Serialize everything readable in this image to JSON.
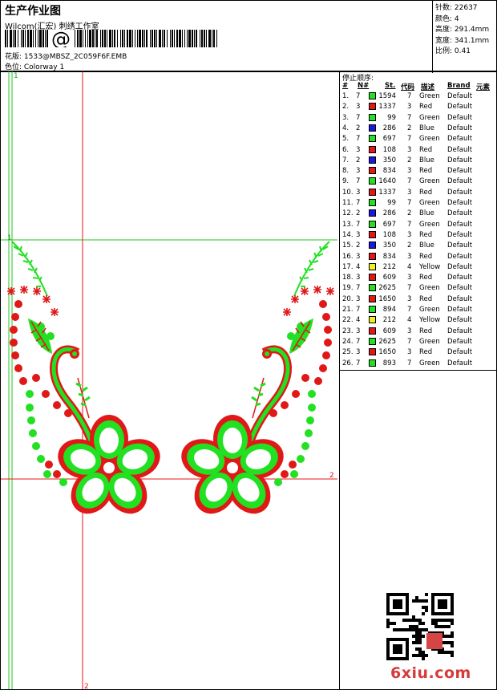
{
  "header": {
    "title": "生产作业图",
    "company": "Wilcom(汇宏) 刺绣工作室",
    "barcode_symbol": "@",
    "design_file": "花版: 1533@MBSZ_2C059F6F.EMB",
    "colorway": "色位: Colorway 1"
  },
  "stats": [
    "针数: 22637",
    "颜色: 4",
    "高度: 291.4mm",
    "宽度: 341.1mm",
    "比例: 0.41"
  ],
  "guides": {
    "v1_label": "1",
    "h1_label": "1",
    "h2_label": "2",
    "v2_label": "2"
  },
  "sequence": {
    "title": "停止顺序:",
    "columns": [
      "#",
      "N#",
      "St.",
      "代码",
      "描述",
      "Brand",
      "元素"
    ],
    "colors": {
      "Green": "#22e022",
      "Red": "#e01818",
      "Blue": "#1818e0",
      "Yellow": "#f0f020"
    },
    "rows": [
      [
        "1.",
        "7",
        "Green",
        "1594",
        "7",
        "Green",
        "Default"
      ],
      [
        "2.",
        "3",
        "Red",
        "1337",
        "3",
        "Red",
        "Default"
      ],
      [
        "3.",
        "7",
        "Green",
        "99",
        "7",
        "Green",
        "Default"
      ],
      [
        "4.",
        "2",
        "Blue",
        "286",
        "2",
        "Blue",
        "Default"
      ],
      [
        "5.",
        "7",
        "Green",
        "697",
        "7",
        "Green",
        "Default"
      ],
      [
        "6.",
        "3",
        "Red",
        "108",
        "3",
        "Red",
        "Default"
      ],
      [
        "7.",
        "2",
        "Blue",
        "350",
        "2",
        "Blue",
        "Default"
      ],
      [
        "8.",
        "3",
        "Red",
        "834",
        "3",
        "Red",
        "Default"
      ],
      [
        "9.",
        "7",
        "Green",
        "1640",
        "7",
        "Green",
        "Default"
      ],
      [
        "10.",
        "3",
        "Red",
        "1337",
        "3",
        "Red",
        "Default"
      ],
      [
        "11.",
        "7",
        "Green",
        "99",
        "7",
        "Green",
        "Default"
      ],
      [
        "12.",
        "2",
        "Blue",
        "286",
        "2",
        "Blue",
        "Default"
      ],
      [
        "13.",
        "7",
        "Green",
        "697",
        "7",
        "Green",
        "Default"
      ],
      [
        "14.",
        "3",
        "Red",
        "108",
        "3",
        "Red",
        "Default"
      ],
      [
        "15.",
        "2",
        "Blue",
        "350",
        "2",
        "Blue",
        "Default"
      ],
      [
        "16.",
        "3",
        "Red",
        "834",
        "3",
        "Red",
        "Default"
      ],
      [
        "17.",
        "4",
        "Yellow",
        "212",
        "4",
        "Yellow",
        "Default"
      ],
      [
        "18.",
        "3",
        "Red",
        "609",
        "3",
        "Red",
        "Default"
      ],
      [
        "19.",
        "7",
        "Green",
        "2625",
        "7",
        "Green",
        "Default"
      ],
      [
        "20.",
        "3",
        "Red",
        "1650",
        "3",
        "Red",
        "Default"
      ],
      [
        "21.",
        "7",
        "Green",
        "894",
        "7",
        "Green",
        "Default"
      ],
      [
        "22.",
        "4",
        "Yellow",
        "212",
        "4",
        "Yellow",
        "Default"
      ],
      [
        "23.",
        "3",
        "Red",
        "609",
        "3",
        "Red",
        "Default"
      ],
      [
        "24.",
        "7",
        "Green",
        "2625",
        "7",
        "Green",
        "Default"
      ],
      [
        "25.",
        "3",
        "Red",
        "1650",
        "3",
        "Red",
        "Default"
      ],
      [
        "26.",
        "7",
        "Green",
        "893",
        "7",
        "Green",
        "Default"
      ]
    ]
  },
  "watermark": "6xiu.com"
}
